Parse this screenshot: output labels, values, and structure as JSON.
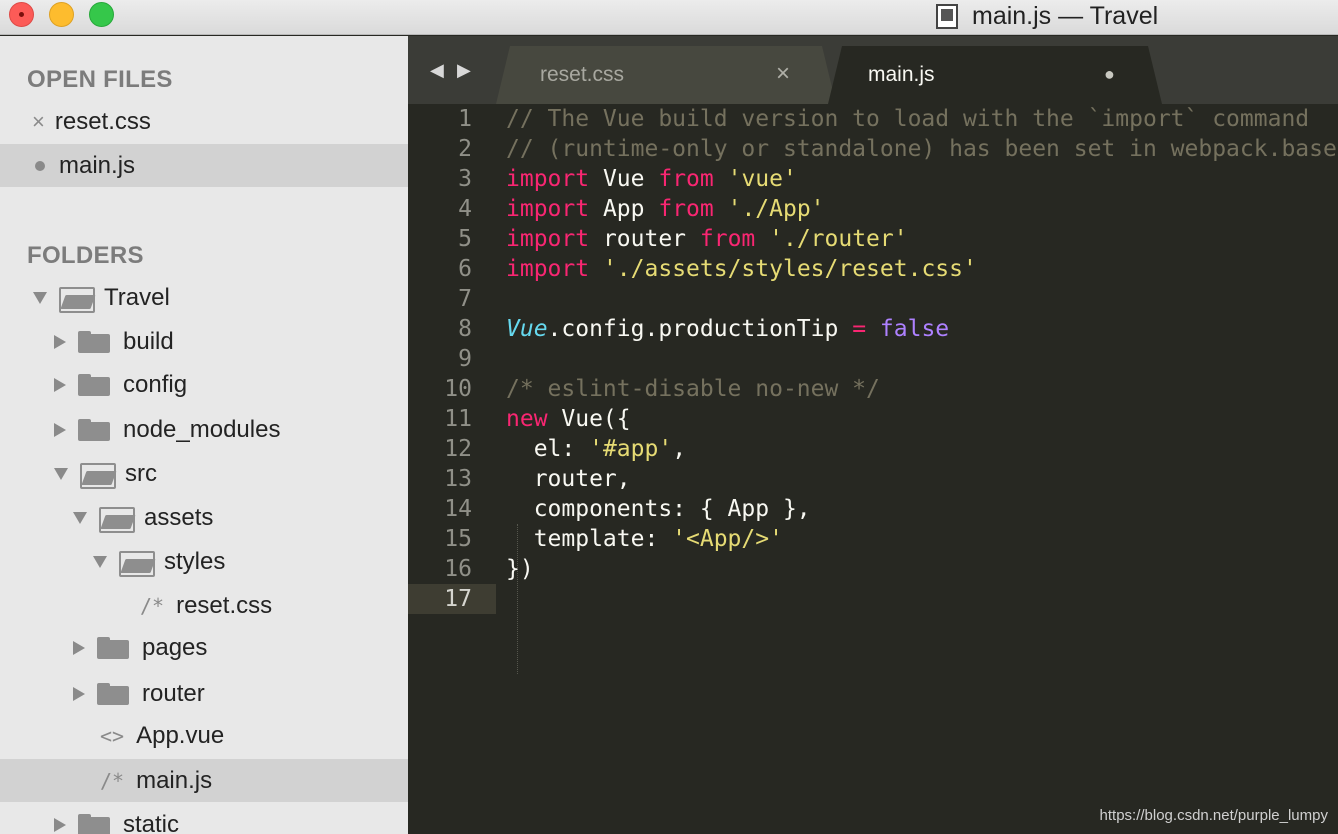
{
  "window": {
    "title": "main.js — Travel"
  },
  "sidebar": {
    "open_files_header": "OPEN FILES",
    "open_files": [
      {
        "name": "reset.css",
        "state": "close",
        "glyph": "×"
      },
      {
        "name": "main.js",
        "state": "modified",
        "selected": true
      }
    ],
    "folders_header": "FOLDERS",
    "tree": [
      {
        "name": "Travel",
        "type": "folder-open",
        "depth": 0
      },
      {
        "name": "build",
        "type": "folder-closed",
        "depth": 1
      },
      {
        "name": "config",
        "type": "folder-closed",
        "depth": 1
      },
      {
        "name": "node_modules",
        "type": "folder-closed",
        "depth": 1
      },
      {
        "name": "src",
        "type": "folder-open",
        "depth": 1
      },
      {
        "name": "assets",
        "type": "folder-open",
        "depth": 2
      },
      {
        "name": "styles",
        "type": "folder-open",
        "depth": 3
      },
      {
        "name": "reset.css",
        "type": "file",
        "glyph": "/*",
        "depth": 4
      },
      {
        "name": "pages",
        "type": "folder-closed",
        "depth": 2
      },
      {
        "name": "router",
        "type": "folder-closed",
        "depth": 2
      },
      {
        "name": "App.vue",
        "type": "file",
        "glyph": "<>",
        "depth": 2
      },
      {
        "name": "main.js",
        "type": "file",
        "glyph": "/*",
        "depth": 2,
        "selected": true
      },
      {
        "name": "static",
        "type": "folder-closed",
        "depth": 1
      }
    ]
  },
  "tabs": {
    "nav_back": "◀",
    "nav_forward": "▶",
    "items": [
      {
        "label": "reset.css",
        "active": false,
        "control": "×"
      },
      {
        "label": "main.js",
        "active": true,
        "control": "●"
      }
    ]
  },
  "editor": {
    "line_numbers": [
      "1",
      "2",
      "3",
      "4",
      "5",
      "6",
      "7",
      "8",
      "9",
      "10",
      "11",
      "12",
      "13",
      "14",
      "15",
      "16",
      "17"
    ],
    "current_line": "17",
    "lines": [
      [
        [
          "cmt",
          "// The Vue build version to load with the `import` command"
        ]
      ],
      [
        [
          "cmt",
          "// (runtime-only or standalone) has been set in webpack.base"
        ]
      ],
      [
        [
          "kw",
          "import"
        ],
        [
          "plain",
          " Vue "
        ],
        [
          "kw",
          "from"
        ],
        [
          "plain",
          " "
        ],
        [
          "str",
          "'vue'"
        ]
      ],
      [
        [
          "kw",
          "import"
        ],
        [
          "plain",
          " App "
        ],
        [
          "kw",
          "from"
        ],
        [
          "plain",
          " "
        ],
        [
          "str",
          "'./App'"
        ]
      ],
      [
        [
          "kw",
          "import"
        ],
        [
          "plain",
          " router "
        ],
        [
          "kw",
          "from"
        ],
        [
          "plain",
          " "
        ],
        [
          "str",
          "'./router'"
        ]
      ],
      [
        [
          "kw",
          "import"
        ],
        [
          "plain",
          " "
        ],
        [
          "str",
          "'./assets/styles/reset.css'"
        ]
      ],
      [],
      [
        [
          "cls",
          "Vue"
        ],
        [
          "plain",
          ".config.productionTip "
        ],
        [
          "kw",
          "="
        ],
        [
          "plain",
          " "
        ],
        [
          "num",
          "false"
        ]
      ],
      [],
      [
        [
          "cmt",
          "/* eslint-disable no-new */"
        ]
      ],
      [
        [
          "kw",
          "new"
        ],
        [
          "plain",
          " Vue({"
        ]
      ],
      [
        [
          "plain",
          "  el: "
        ],
        [
          "str",
          "'#app'"
        ],
        [
          "plain",
          ","
        ]
      ],
      [
        [
          "plain",
          "  router,"
        ]
      ],
      [
        [
          "plain",
          "  components: { App },"
        ]
      ],
      [
        [
          "plain",
          "  template: "
        ],
        [
          "str",
          "'<App/>'"
        ]
      ],
      [
        [
          "plain",
          "})"
        ]
      ],
      []
    ]
  },
  "watermark": "https://blog.csdn.net/purple_lumpy"
}
